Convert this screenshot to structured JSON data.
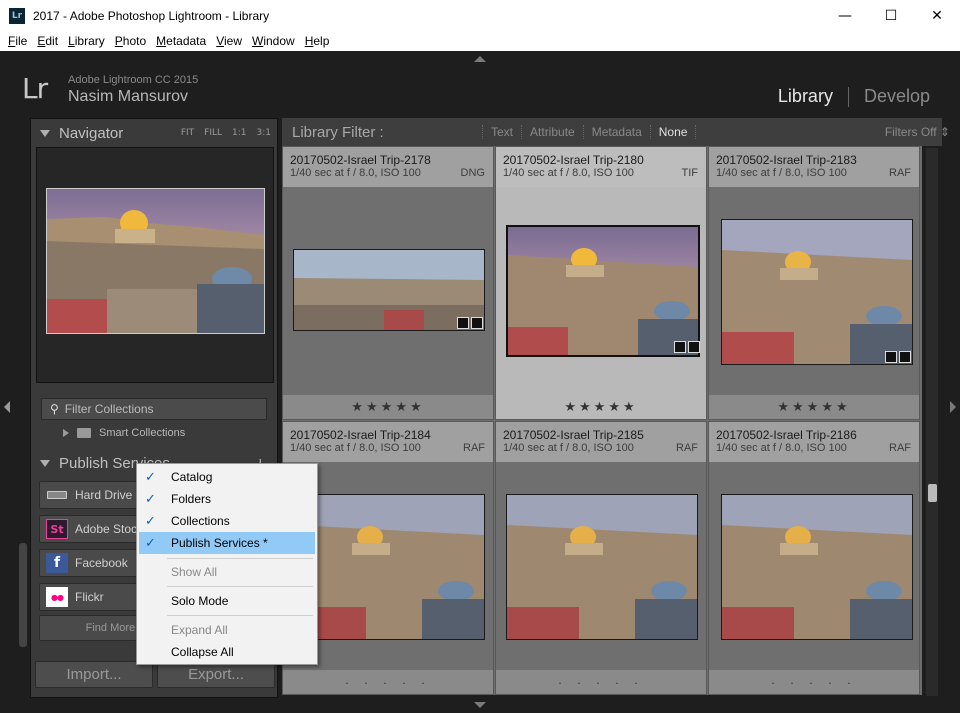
{
  "window": {
    "title": "2017 - Adobe Photoshop Lightroom - Library",
    "app_icon": "Lr",
    "minimize": "—",
    "maximize": "☐",
    "close": "✕"
  },
  "menu": [
    "File",
    "Edit",
    "Library",
    "Photo",
    "Metadata",
    "View",
    "Window",
    "Help"
  ],
  "identity": {
    "logo": "Lr",
    "product": "Adobe Lightroom CC 2015",
    "user": "Nasim Mansurov"
  },
  "modules": {
    "active": "Library",
    "next": "Develop"
  },
  "navigator": {
    "title": "Navigator",
    "options": [
      "FIT",
      "FILL",
      "1:1",
      "3:1"
    ]
  },
  "collections": {
    "filter_placeholder": "Filter Collections",
    "smart": "Smart Collections"
  },
  "publish": {
    "title": "Publish Services",
    "services": [
      {
        "label": "Hard Drive",
        "icon": "hard-drive-icon"
      },
      {
        "label": "Adobe Stock",
        "icon": "adobe-stock-icon",
        "icon_text": "St"
      },
      {
        "label": "Facebook",
        "icon": "facebook-icon",
        "icon_text": "f"
      },
      {
        "label": "Flickr",
        "icon": "flickr-icon",
        "icon_text": "●●"
      }
    ],
    "find_more": "Find More Services Online..."
  },
  "buttons": {
    "import": "Import...",
    "export": "Export..."
  },
  "library_filter": {
    "title": "Library Filter :",
    "options": [
      "Text",
      "Attribute",
      "Metadata",
      "None"
    ],
    "selected": "None",
    "filters_off": "Filters Off ⇕"
  },
  "photos": [
    {
      "name": "20170502-Israel Trip-2178",
      "meta": "1/40 sec at f / 8.0, ISO 100",
      "ext": "DNG",
      "rating": "★★★★★"
    },
    {
      "name": "20170502-Israel Trip-2180",
      "meta": "1/40 sec at f / 8.0, ISO 100",
      "ext": "TIF",
      "rating": "★★★★★"
    },
    {
      "name": "20170502-Israel Trip-2183",
      "meta": "1/40 sec at f / 8.0, ISO 100",
      "ext": "RAF",
      "rating": "★★★★★"
    },
    {
      "name": "20170502-Israel Trip-2184",
      "meta": "1/40 sec at f / 8.0, ISO 100",
      "ext": "RAF",
      "rating": "· · · · ·"
    },
    {
      "name": "20170502-Israel Trip-2185",
      "meta": "1/40 sec at f / 8.0, ISO 100",
      "ext": "RAF",
      "rating": "· · · · ·"
    },
    {
      "name": "20170502-Israel Trip-2186",
      "meta": "1/40 sec at f / 8.0, ISO 100",
      "ext": "RAF",
      "rating": "· · · · ·"
    }
  ],
  "context_menu": {
    "checked": [
      "Catalog",
      "Folders",
      "Collections",
      "Publish Services *"
    ],
    "show_all": "Show All",
    "solo_mode": "Solo Mode",
    "expand_all": "Expand All",
    "collapse_all": "Collapse All",
    "check_mark": "✓"
  },
  "colors": {
    "highlight": "#91c9f7",
    "panel": "#3a3a3a",
    "grid": "#6e6e6e"
  }
}
